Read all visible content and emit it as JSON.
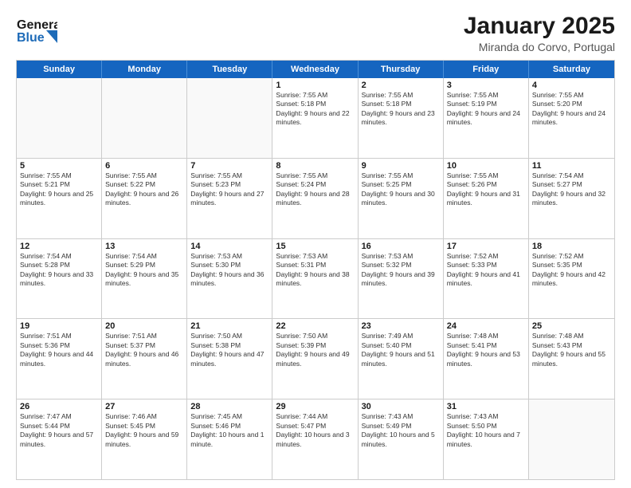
{
  "header": {
    "logo_line1": "General",
    "logo_line2": "Blue",
    "month_title": "January 2025",
    "location": "Miranda do Corvo, Portugal"
  },
  "weekdays": [
    "Sunday",
    "Monday",
    "Tuesday",
    "Wednesday",
    "Thursday",
    "Friday",
    "Saturday"
  ],
  "rows": [
    [
      {
        "day": "",
        "info": ""
      },
      {
        "day": "",
        "info": ""
      },
      {
        "day": "",
        "info": ""
      },
      {
        "day": "1",
        "info": "Sunrise: 7:55 AM\nSunset: 5:18 PM\nDaylight: 9 hours and 22 minutes."
      },
      {
        "day": "2",
        "info": "Sunrise: 7:55 AM\nSunset: 5:18 PM\nDaylight: 9 hours and 23 minutes."
      },
      {
        "day": "3",
        "info": "Sunrise: 7:55 AM\nSunset: 5:19 PM\nDaylight: 9 hours and 24 minutes."
      },
      {
        "day": "4",
        "info": "Sunrise: 7:55 AM\nSunset: 5:20 PM\nDaylight: 9 hours and 24 minutes."
      }
    ],
    [
      {
        "day": "5",
        "info": "Sunrise: 7:55 AM\nSunset: 5:21 PM\nDaylight: 9 hours and 25 minutes."
      },
      {
        "day": "6",
        "info": "Sunrise: 7:55 AM\nSunset: 5:22 PM\nDaylight: 9 hours and 26 minutes."
      },
      {
        "day": "7",
        "info": "Sunrise: 7:55 AM\nSunset: 5:23 PM\nDaylight: 9 hours and 27 minutes."
      },
      {
        "day": "8",
        "info": "Sunrise: 7:55 AM\nSunset: 5:24 PM\nDaylight: 9 hours and 28 minutes."
      },
      {
        "day": "9",
        "info": "Sunrise: 7:55 AM\nSunset: 5:25 PM\nDaylight: 9 hours and 30 minutes."
      },
      {
        "day": "10",
        "info": "Sunrise: 7:55 AM\nSunset: 5:26 PM\nDaylight: 9 hours and 31 minutes."
      },
      {
        "day": "11",
        "info": "Sunrise: 7:54 AM\nSunset: 5:27 PM\nDaylight: 9 hours and 32 minutes."
      }
    ],
    [
      {
        "day": "12",
        "info": "Sunrise: 7:54 AM\nSunset: 5:28 PM\nDaylight: 9 hours and 33 minutes."
      },
      {
        "day": "13",
        "info": "Sunrise: 7:54 AM\nSunset: 5:29 PM\nDaylight: 9 hours and 35 minutes."
      },
      {
        "day": "14",
        "info": "Sunrise: 7:53 AM\nSunset: 5:30 PM\nDaylight: 9 hours and 36 minutes."
      },
      {
        "day": "15",
        "info": "Sunrise: 7:53 AM\nSunset: 5:31 PM\nDaylight: 9 hours and 38 minutes."
      },
      {
        "day": "16",
        "info": "Sunrise: 7:53 AM\nSunset: 5:32 PM\nDaylight: 9 hours and 39 minutes."
      },
      {
        "day": "17",
        "info": "Sunrise: 7:52 AM\nSunset: 5:33 PM\nDaylight: 9 hours and 41 minutes."
      },
      {
        "day": "18",
        "info": "Sunrise: 7:52 AM\nSunset: 5:35 PM\nDaylight: 9 hours and 42 minutes."
      }
    ],
    [
      {
        "day": "19",
        "info": "Sunrise: 7:51 AM\nSunset: 5:36 PM\nDaylight: 9 hours and 44 minutes."
      },
      {
        "day": "20",
        "info": "Sunrise: 7:51 AM\nSunset: 5:37 PM\nDaylight: 9 hours and 46 minutes."
      },
      {
        "day": "21",
        "info": "Sunrise: 7:50 AM\nSunset: 5:38 PM\nDaylight: 9 hours and 47 minutes."
      },
      {
        "day": "22",
        "info": "Sunrise: 7:50 AM\nSunset: 5:39 PM\nDaylight: 9 hours and 49 minutes."
      },
      {
        "day": "23",
        "info": "Sunrise: 7:49 AM\nSunset: 5:40 PM\nDaylight: 9 hours and 51 minutes."
      },
      {
        "day": "24",
        "info": "Sunrise: 7:48 AM\nSunset: 5:41 PM\nDaylight: 9 hours and 53 minutes."
      },
      {
        "day": "25",
        "info": "Sunrise: 7:48 AM\nSunset: 5:43 PM\nDaylight: 9 hours and 55 minutes."
      }
    ],
    [
      {
        "day": "26",
        "info": "Sunrise: 7:47 AM\nSunset: 5:44 PM\nDaylight: 9 hours and 57 minutes."
      },
      {
        "day": "27",
        "info": "Sunrise: 7:46 AM\nSunset: 5:45 PM\nDaylight: 9 hours and 59 minutes."
      },
      {
        "day": "28",
        "info": "Sunrise: 7:45 AM\nSunset: 5:46 PM\nDaylight: 10 hours and 1 minute."
      },
      {
        "day": "29",
        "info": "Sunrise: 7:44 AM\nSunset: 5:47 PM\nDaylight: 10 hours and 3 minutes."
      },
      {
        "day": "30",
        "info": "Sunrise: 7:43 AM\nSunset: 5:49 PM\nDaylight: 10 hours and 5 minutes."
      },
      {
        "day": "31",
        "info": "Sunrise: 7:43 AM\nSunset: 5:50 PM\nDaylight: 10 hours and 7 minutes."
      },
      {
        "day": "",
        "info": ""
      }
    ]
  ]
}
